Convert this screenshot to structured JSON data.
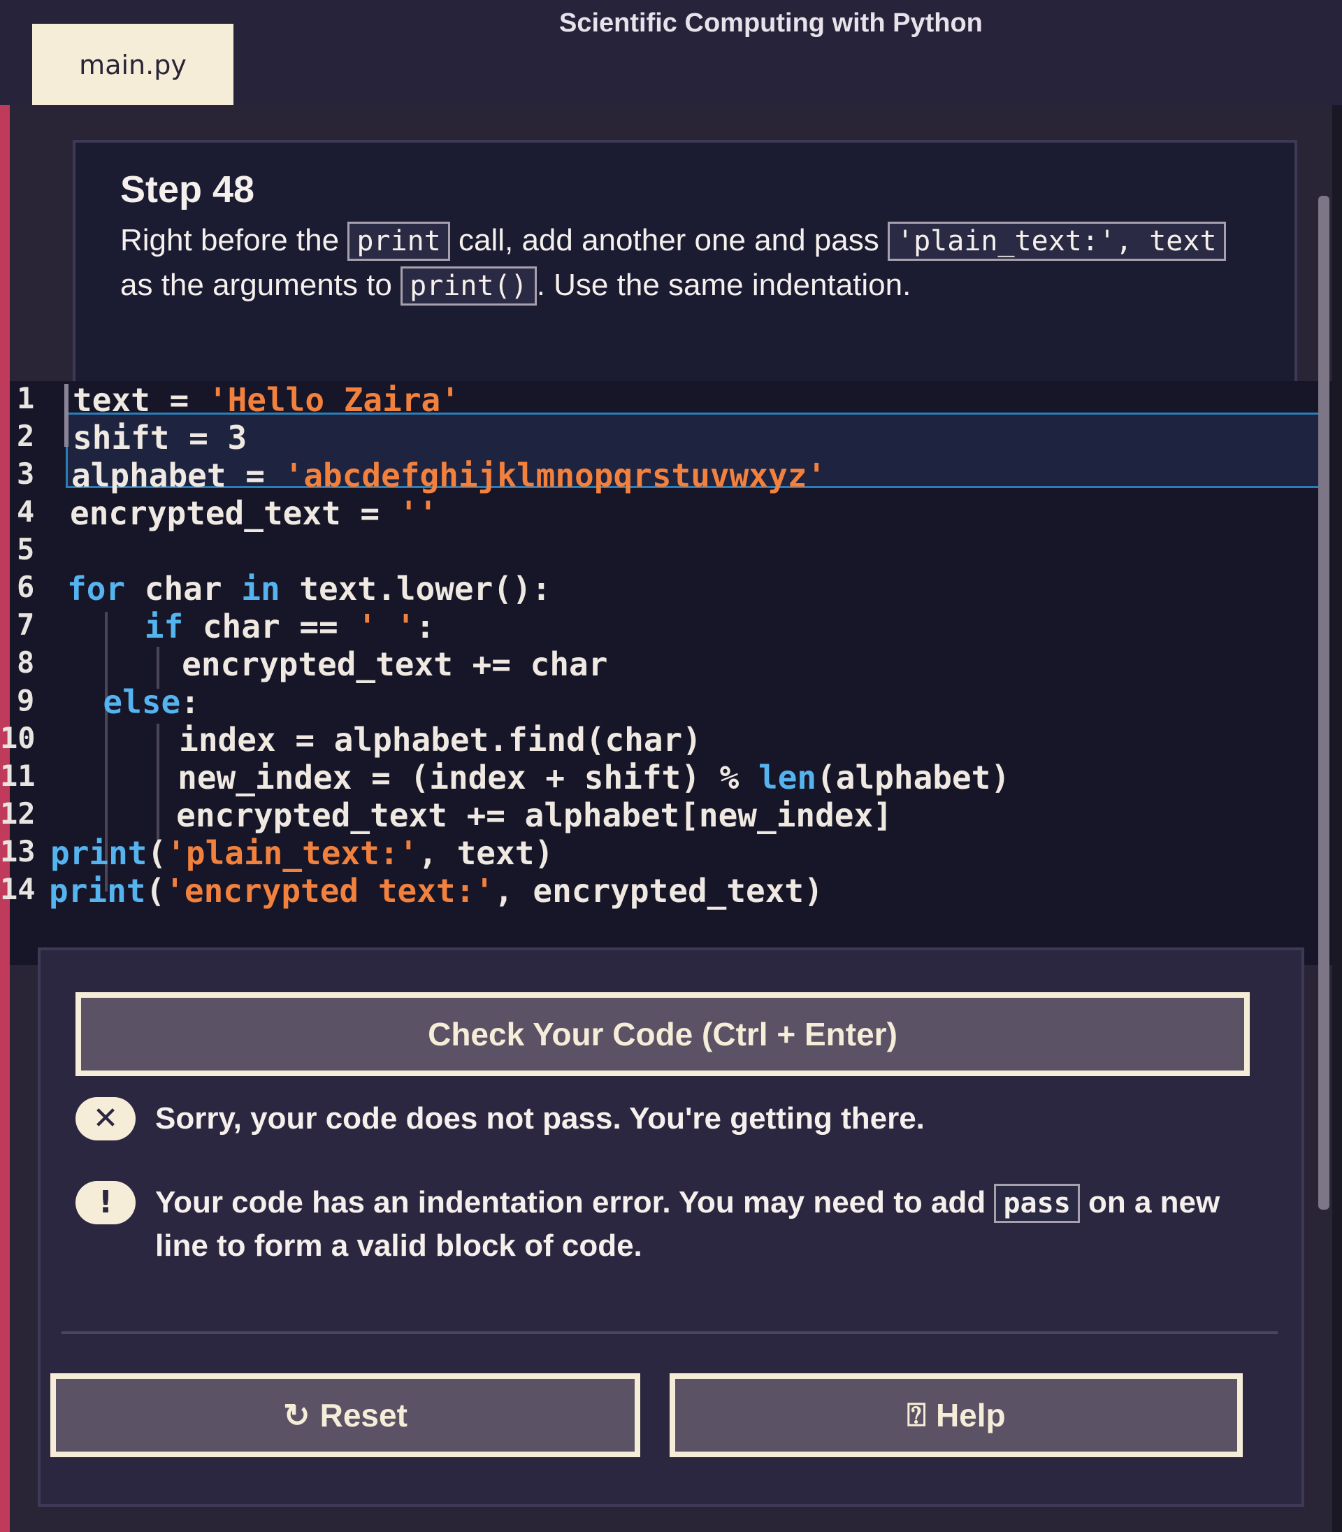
{
  "app": {
    "title": "Scientific Computing with Python",
    "file_tab": "main.py"
  },
  "instructions": {
    "step": "Step 48",
    "text_1": "Right before the ",
    "code_1": "print",
    "text_2": " call, add another one and pass ",
    "code_2": "'plain_text:', text",
    "text_3": " as the arguments to ",
    "code_3": "print()",
    "text_4": ". Use the same indentation."
  },
  "editor": {
    "line_numbers": [
      "1",
      "2",
      "3",
      "4",
      "5",
      "6",
      "7",
      "8",
      "9",
      "10",
      "11",
      "12",
      "13",
      "14"
    ],
    "lines": [
      "text = 'Hello Zaira'",
      "shift = 3",
      "alphabet = 'abcdefghijklmnopqrstuvwxyz'",
      "encrypted_text = ''",
      "",
      "for char in text.lower():",
      "    if char == ' ':",
      "        encrypted_text += char",
      "    else:",
      "        index = alphabet.find(char)",
      "        new_index = (index + shift) % len(alphabet)",
      "        encrypted_text += alphabet[new_index]",
      "print('plain_text:', text)",
      "print('encrypted text:', encrypted_text)"
    ]
  },
  "actions": {
    "check_label": "Check Your Code (Ctrl + Enter)",
    "fail_message": "Sorry, your code does not pass. You're getting there.",
    "hint_text_1": "Your code has an indentation error. You may need to add ",
    "hint_code": "pass",
    "hint_text_2": " on a new line to form a valid block of code.",
    "reset_label": "Reset",
    "help_label": "Help"
  },
  "icons": {
    "fail": "close-circle-icon",
    "hint": "lightbulb-icon",
    "reset": "reset-icon",
    "help": "help-icon"
  },
  "colors": {
    "string": "#f2813d",
    "keyword": "#55b4ef",
    "button_border": "#f6edd9"
  }
}
